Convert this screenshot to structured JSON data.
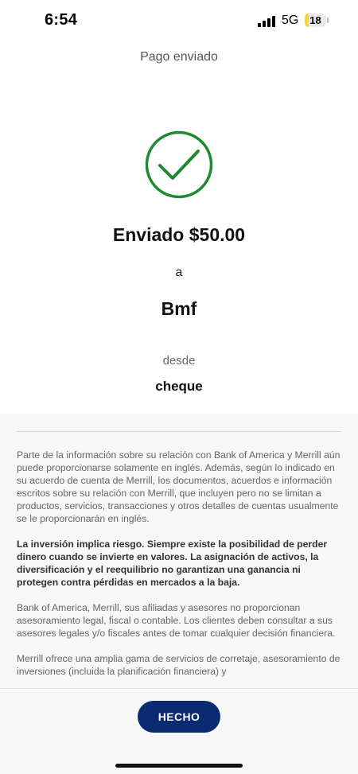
{
  "status_bar": {
    "time": "6:54",
    "network": "5G",
    "battery_level": "18",
    "battery_fraction": 0.18,
    "battery_color": "#f5d53a"
  },
  "header": {
    "title": "Pago enviado"
  },
  "confirmation": {
    "icon": "checkmark-circle-icon",
    "icon_color": "#1e8a2e",
    "sent_amount": "Enviado $50.00",
    "to_word": "a",
    "recipient": "Bmf",
    "from_word": "desde",
    "account": "cheque"
  },
  "disclosures": {
    "paragraphs": [
      "Parte de la información sobre su relación con Bank of America y Merrill aún puede proporcionarse solamente en inglés. Además, según lo indicado en su acuerdo de cuenta de Merrill, los documentos, acuerdos e información escritos sobre su relación con Merrill, que incluyen pero no se limitan a productos, servicios, transacciones y otros detalles de cuentas usualmente se le proporcionarán en inglés.",
      "La inversión implica riesgo. Siempre existe la posibilidad de perder dinero cuando se invierte en valores. La asignación de activos, la diversificación y el reequilibrio no garantizan una ganancia ni protegen contra pérdidas en mercados a la baja.",
      "Bank of America, Merrill, sus afiliadas y asesores no proporcionan asesoramiento legal, fiscal o contable. Los clientes deben consultar a sus asesores legales y/o fiscales antes de tomar cualquier decisión financiera.",
      "Merrill ofrece una amplia gama de servicios de corretaje, asesoramiento de inversiones (incluida la planificación financiera) y"
    ]
  },
  "footer": {
    "done_label": "HECHO",
    "button_color": "#0a2a73"
  }
}
